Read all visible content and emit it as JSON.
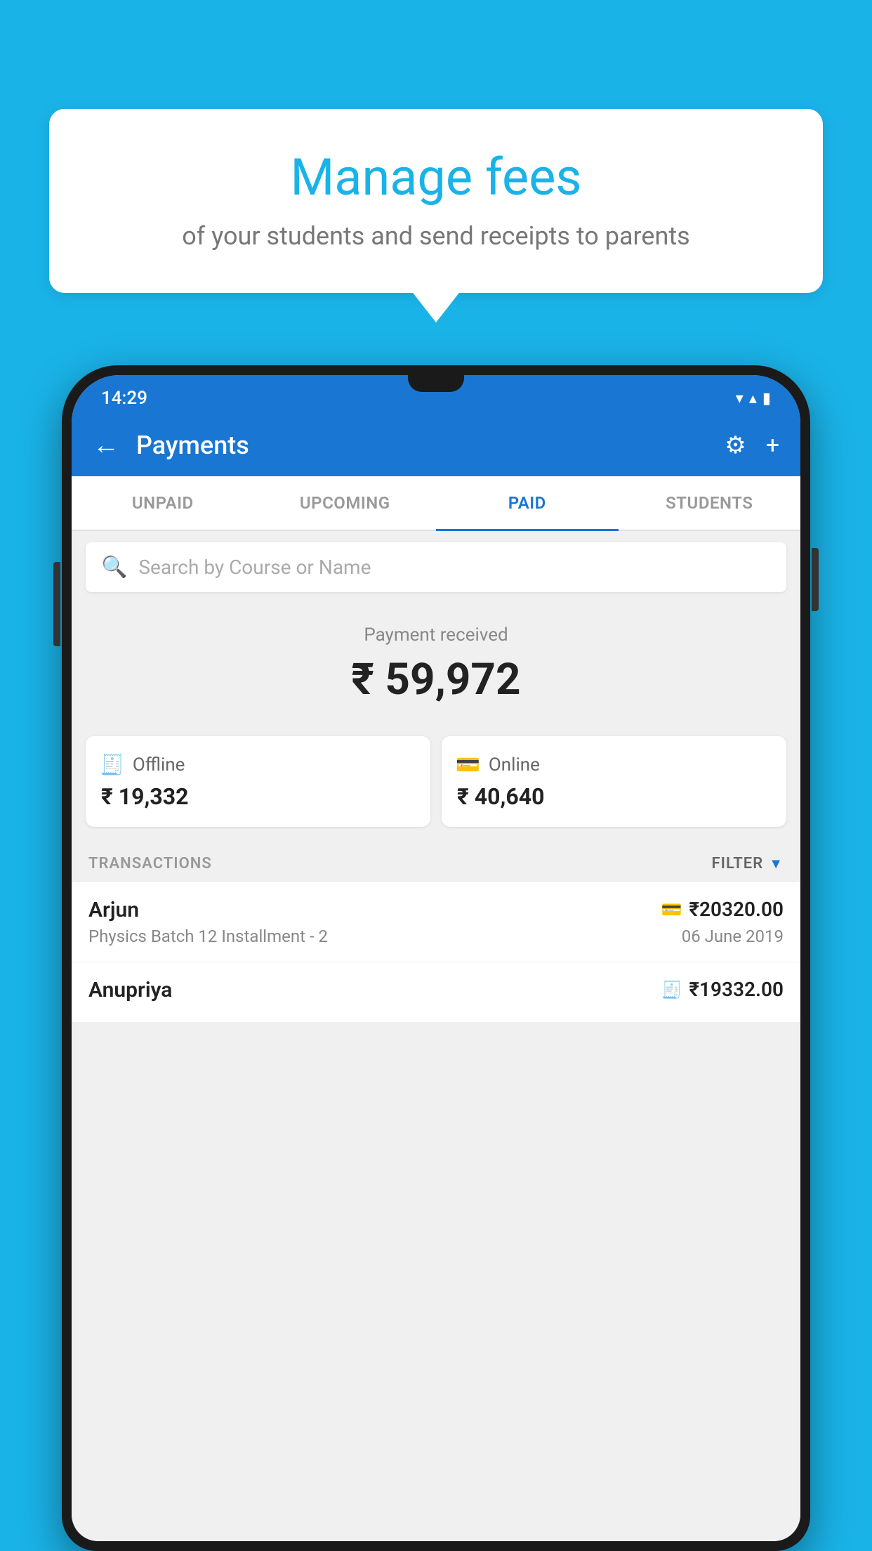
{
  "background_color": "#1ab3e8",
  "bubble": {
    "title": "Manage fees",
    "subtitle": "of your students and send receipts to parents"
  },
  "status_bar": {
    "time": "14:29",
    "wifi_icon": "▲",
    "signal_icon": "▲",
    "battery_icon": "▮"
  },
  "header": {
    "title": "Payments",
    "back_icon": "←",
    "settings_icon": "⚙",
    "add_icon": "+"
  },
  "tabs": [
    {
      "label": "UNPAID",
      "active": false
    },
    {
      "label": "UPCOMING",
      "active": false
    },
    {
      "label": "PAID",
      "active": true
    },
    {
      "label": "STUDENTS",
      "active": false
    }
  ],
  "search": {
    "placeholder": "Search by Course or Name"
  },
  "payment_received": {
    "label": "Payment received",
    "amount": "₹ 59,972"
  },
  "payment_methods": [
    {
      "label": "Offline",
      "amount": "₹ 19,332",
      "icon": "offline"
    },
    {
      "label": "Online",
      "amount": "₹ 40,640",
      "icon": "online"
    }
  ],
  "transactions_header": {
    "label": "TRANSACTIONS",
    "filter_label": "FILTER"
  },
  "transactions": [
    {
      "name": "Arjun",
      "course": "Physics Batch 12 Installment - 2",
      "amount": "₹20320.00",
      "date": "06 June 2019",
      "payment_type": "card"
    },
    {
      "name": "Anupriya",
      "course": "",
      "amount": "₹19332.00",
      "date": "",
      "payment_type": "cash"
    }
  ]
}
